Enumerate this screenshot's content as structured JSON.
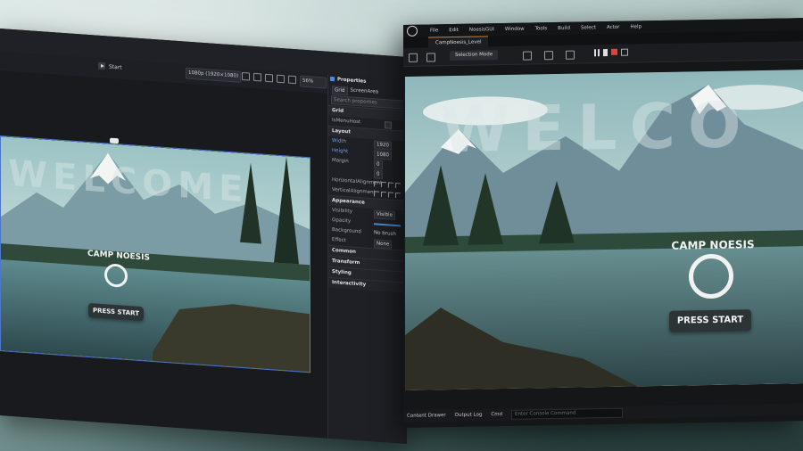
{
  "studio": {
    "start_label": "Start",
    "resolution": "1080p (1920×1080)",
    "zoom": "56%",
    "welcome_text": "WELCOME",
    "brand_text": "CAMP NOESIS",
    "press_start": "PRESS START",
    "properties": {
      "title": "Properties",
      "element_type": "Grid",
      "element_name": "ScreenArea",
      "search_placeholder": "Search properties",
      "grid_section": "Grid",
      "is_menu_host_label": "IsMenuHost",
      "layout_section": "Layout",
      "width_label": "Width",
      "width_value": "1920",
      "height_label": "Height",
      "height_value": "1080",
      "margin_label": "Margin",
      "margin_a": "0",
      "margin_b": "0",
      "halign_label": "HorizontalAlignment",
      "valign_label": "VerticalAlignment",
      "appearance_section": "Appearance",
      "visibility_label": "Visibility",
      "visibility_value": "Visible",
      "opacity_label": "Opacity",
      "background_label": "Background",
      "background_value": "No brush",
      "effect_label": "Effect",
      "effect_value": "None",
      "common_section": "Common",
      "transform_section": "Transform",
      "styling_section": "Styling",
      "interactivity_section": "Interactivity"
    }
  },
  "unreal": {
    "menu": [
      "File",
      "Edit",
      "NoesisGUI",
      "Window",
      "Tools",
      "Build",
      "Select",
      "Actor",
      "Help"
    ],
    "tab_label": "CampNoesis_Level",
    "selection_mode": "Selection Mode",
    "welcome_text": "WELCO",
    "brand_text": "CAMP NOESIS",
    "press_start": "PRESS START",
    "status": {
      "content_drawer": "Content Drawer",
      "output_log": "Output Log",
      "cmd": "Cmd",
      "console_placeholder": "Enter Console Command"
    }
  },
  "colors": {
    "accent_blue": "#4c8bd6",
    "ue_tab_accent": "#e07b16",
    "record_red": "#e0433a",
    "play_green": "#4fb34f"
  }
}
